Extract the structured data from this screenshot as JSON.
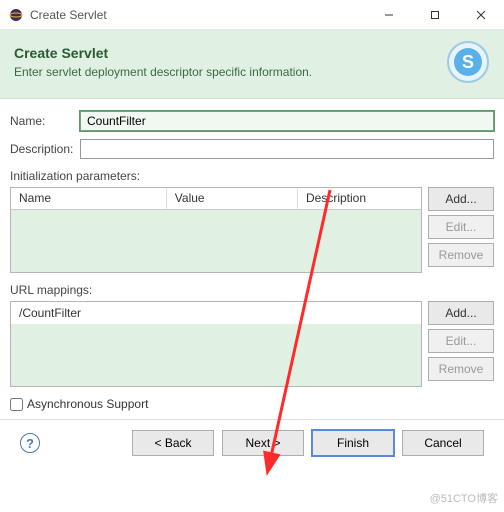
{
  "window": {
    "title": "Create Servlet"
  },
  "banner": {
    "heading": "Create Servlet",
    "subheading": "Enter servlet deployment descriptor specific information."
  },
  "form": {
    "name_label": "Name:",
    "name_value": "CountFilter",
    "description_label": "Description:",
    "description_value": ""
  },
  "init_params": {
    "section_label": "Initialization parameters:",
    "columns": {
      "name": "Name",
      "value": "Value",
      "description": "Description"
    },
    "rows": [],
    "buttons": {
      "add": "Add...",
      "edit": "Edit...",
      "remove": "Remove"
    }
  },
  "url_mappings": {
    "section_label": "URL mappings:",
    "items": [
      "/CountFilter"
    ],
    "buttons": {
      "add": "Add...",
      "edit": "Edit...",
      "remove": "Remove"
    }
  },
  "async": {
    "label": "Asynchronous Support",
    "checked": false
  },
  "footer": {
    "back": "< Back",
    "next": "Next >",
    "finish": "Finish",
    "cancel": "Cancel"
  },
  "watermark": "@51CTO博客"
}
